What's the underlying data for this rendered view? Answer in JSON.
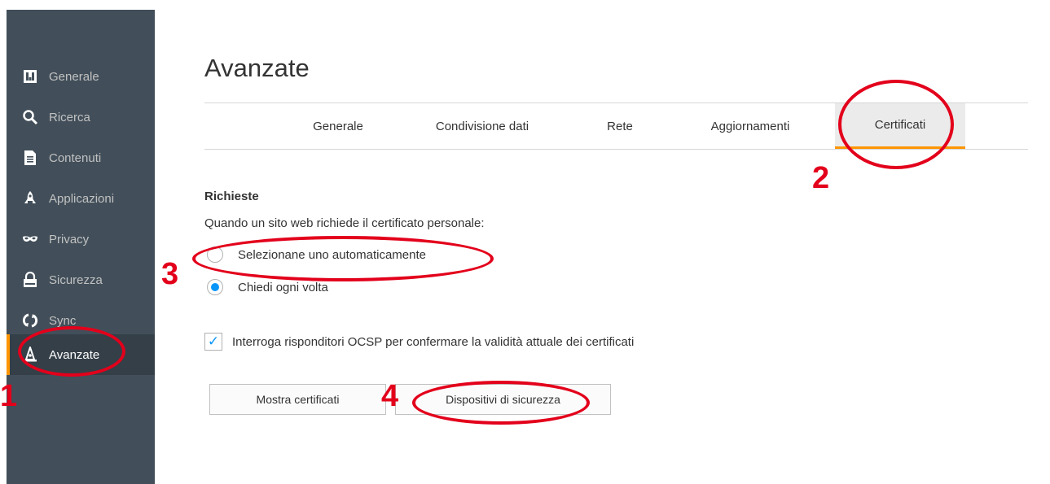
{
  "sidebar": {
    "items": [
      {
        "label": "Generale",
        "icon": "general-icon"
      },
      {
        "label": "Ricerca",
        "icon": "search-icon"
      },
      {
        "label": "Contenuti",
        "icon": "document-icon"
      },
      {
        "label": "Applicazioni",
        "icon": "rocket-icon"
      },
      {
        "label": "Privacy",
        "icon": "mask-icon"
      },
      {
        "label": "Sicurezza",
        "icon": "lock-icon"
      },
      {
        "label": "Sync",
        "icon": "sync-icon"
      },
      {
        "label": "Avanzate",
        "icon": "wizard-hat-icon",
        "selected": true
      }
    ]
  },
  "main": {
    "title": "Avanzate",
    "tabs": [
      {
        "label": "Generale"
      },
      {
        "label": "Condivisione dati"
      },
      {
        "label": "Rete"
      },
      {
        "label": "Aggiornamenti"
      },
      {
        "label": "Certificati",
        "selected": true
      }
    ],
    "section_title": "Richieste",
    "section_desc": "Quando un sito web richiede il certificato personale:",
    "radios": [
      {
        "label": "Selezionane uno automaticamente",
        "checked": false
      },
      {
        "label": "Chiedi ogni volta",
        "checked": true
      }
    ],
    "ocsp": {
      "label": "Interroga risponditori OCSP per confermare la validità attuale dei certificati",
      "checked": true
    },
    "buttons": {
      "show_certs": "Mostra certificati",
      "security_devices": "Dispositivi di sicurezza"
    }
  },
  "annotations": {
    "step1": "1",
    "step2": "2",
    "step3": "3",
    "step4": "4",
    "color": "#e3001b"
  },
  "colors": {
    "sidebar_bg": "#424f5a",
    "accent": "#ff9500",
    "radio_checked": "#0996f8"
  }
}
